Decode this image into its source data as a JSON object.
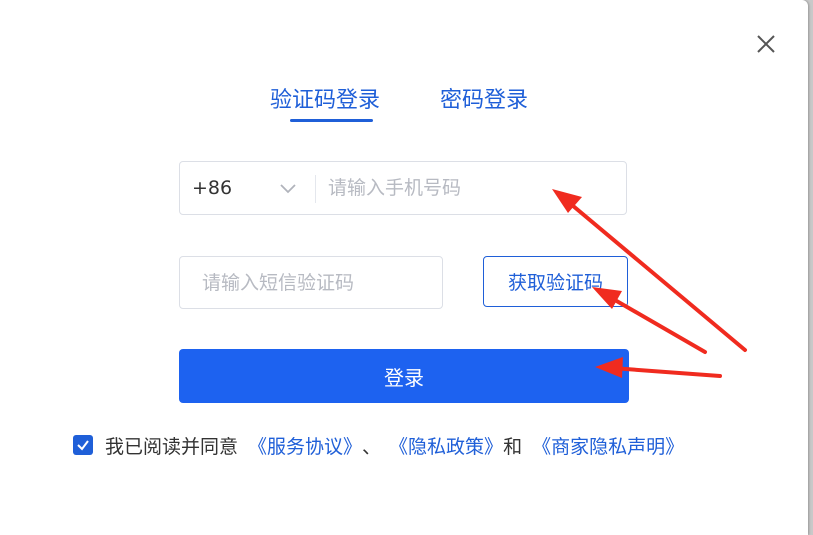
{
  "tabs": [
    {
      "label": "验证码登录",
      "active": true
    },
    {
      "label": "密码登录",
      "active": false
    }
  ],
  "phone": {
    "country_code": "+86",
    "placeholder": "请输入手机号码",
    "value": ""
  },
  "sms_code": {
    "placeholder": "请输入短信验证码",
    "value": "",
    "get_code_label": "获取验证码"
  },
  "login_button": "登录",
  "agreement": {
    "checked": true,
    "prefix": "我已阅读并同意",
    "link_service": "《服务协议》",
    "separator": "、",
    "link_privacy": "《隐私政策》",
    "and": "和",
    "link_merchant_privacy": "《商家隐私声明》"
  },
  "colors": {
    "primary": "#1d62f0",
    "link": "#1f5fd8",
    "annotation_arrow": "#f02b1f"
  },
  "icons": [
    "close-icon",
    "chevron-down-icon",
    "check-icon"
  ]
}
